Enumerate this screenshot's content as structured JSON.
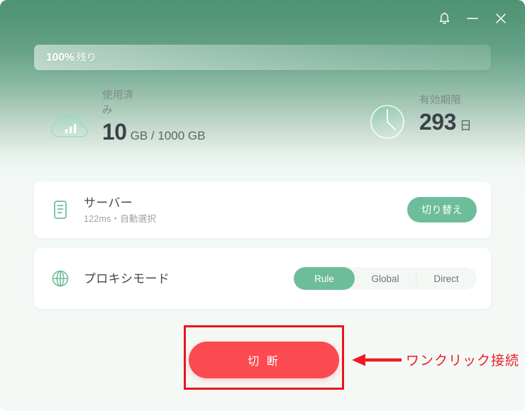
{
  "window": {
    "controls": [
      {
        "name": "notifications-button",
        "icon": "bell-icon",
        "label": ""
      },
      {
        "name": "minimize-button",
        "icon": "minimize-icon",
        "label": ""
      },
      {
        "name": "close-button",
        "icon": "close-icon",
        "label": ""
      }
    ]
  },
  "quota_bar": {
    "percent_label": "100%",
    "remaining_label": "残り",
    "percent_value": 100,
    "fill_color": "#ffffff"
  },
  "stats": {
    "usage": {
      "icon": "cloud-chart-icon",
      "label": "使用済み",
      "value": "10",
      "unit": "GB / 1000 GB"
    },
    "expiry": {
      "icon": "clock-icon",
      "label": "有効期限",
      "value": "293",
      "unit": "日"
    }
  },
  "cards": {
    "server": {
      "icon": "server-list-icon",
      "title": "サーバー",
      "subtitle": "122ms・自動選択",
      "action_label": "切り替え"
    },
    "proxy": {
      "icon": "globe-icon",
      "title": "プロキシモード",
      "modes": [
        {
          "label": "Rule",
          "active": true
        },
        {
          "label": "Global",
          "active": false
        },
        {
          "label": "Direct",
          "active": false
        }
      ]
    }
  },
  "connection": {
    "button_label": "切 断",
    "button_color": "#fb4b50"
  },
  "annotation": {
    "text": "ワンクリック接続",
    "color": "#ec1c24"
  },
  "theme": {
    "accent_green": "#6dbd9b",
    "header_green": "#4f9374",
    "page_background": "#f4f9f6",
    "danger_red": "#fb4b50"
  }
}
